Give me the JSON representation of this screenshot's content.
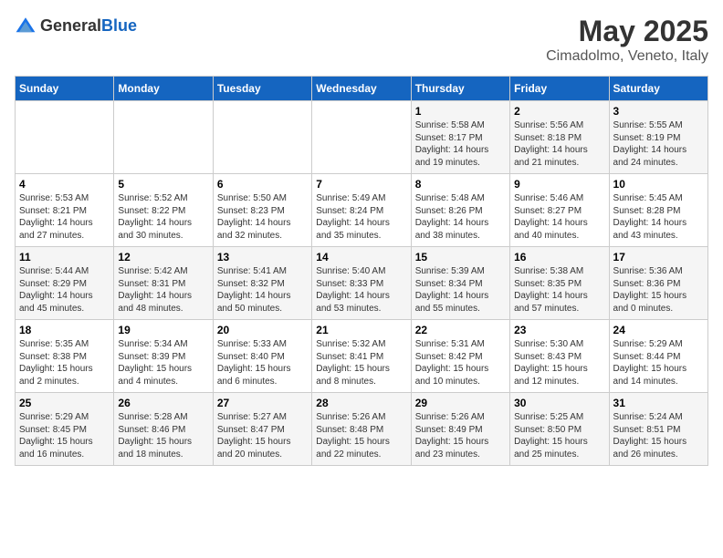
{
  "header": {
    "logo_general": "General",
    "logo_blue": "Blue",
    "main_title": "May 2025",
    "subtitle": "Cimadolmo, Veneto, Italy"
  },
  "weekdays": [
    "Sunday",
    "Monday",
    "Tuesday",
    "Wednesday",
    "Thursday",
    "Friday",
    "Saturday"
  ],
  "weeks": [
    [
      {
        "day": "",
        "info": ""
      },
      {
        "day": "",
        "info": ""
      },
      {
        "day": "",
        "info": ""
      },
      {
        "day": "",
        "info": ""
      },
      {
        "day": "1",
        "info": "Sunrise: 5:58 AM\nSunset: 8:17 PM\nDaylight: 14 hours\nand 19 minutes."
      },
      {
        "day": "2",
        "info": "Sunrise: 5:56 AM\nSunset: 8:18 PM\nDaylight: 14 hours\nand 21 minutes."
      },
      {
        "day": "3",
        "info": "Sunrise: 5:55 AM\nSunset: 8:19 PM\nDaylight: 14 hours\nand 24 minutes."
      }
    ],
    [
      {
        "day": "4",
        "info": "Sunrise: 5:53 AM\nSunset: 8:21 PM\nDaylight: 14 hours\nand 27 minutes."
      },
      {
        "day": "5",
        "info": "Sunrise: 5:52 AM\nSunset: 8:22 PM\nDaylight: 14 hours\nand 30 minutes."
      },
      {
        "day": "6",
        "info": "Sunrise: 5:50 AM\nSunset: 8:23 PM\nDaylight: 14 hours\nand 32 minutes."
      },
      {
        "day": "7",
        "info": "Sunrise: 5:49 AM\nSunset: 8:24 PM\nDaylight: 14 hours\nand 35 minutes."
      },
      {
        "day": "8",
        "info": "Sunrise: 5:48 AM\nSunset: 8:26 PM\nDaylight: 14 hours\nand 38 minutes."
      },
      {
        "day": "9",
        "info": "Sunrise: 5:46 AM\nSunset: 8:27 PM\nDaylight: 14 hours\nand 40 minutes."
      },
      {
        "day": "10",
        "info": "Sunrise: 5:45 AM\nSunset: 8:28 PM\nDaylight: 14 hours\nand 43 minutes."
      }
    ],
    [
      {
        "day": "11",
        "info": "Sunrise: 5:44 AM\nSunset: 8:29 PM\nDaylight: 14 hours\nand 45 minutes."
      },
      {
        "day": "12",
        "info": "Sunrise: 5:42 AM\nSunset: 8:31 PM\nDaylight: 14 hours\nand 48 minutes."
      },
      {
        "day": "13",
        "info": "Sunrise: 5:41 AM\nSunset: 8:32 PM\nDaylight: 14 hours\nand 50 minutes."
      },
      {
        "day": "14",
        "info": "Sunrise: 5:40 AM\nSunset: 8:33 PM\nDaylight: 14 hours\nand 53 minutes."
      },
      {
        "day": "15",
        "info": "Sunrise: 5:39 AM\nSunset: 8:34 PM\nDaylight: 14 hours\nand 55 minutes."
      },
      {
        "day": "16",
        "info": "Sunrise: 5:38 AM\nSunset: 8:35 PM\nDaylight: 14 hours\nand 57 minutes."
      },
      {
        "day": "17",
        "info": "Sunrise: 5:36 AM\nSunset: 8:36 PM\nDaylight: 15 hours\nand 0 minutes."
      }
    ],
    [
      {
        "day": "18",
        "info": "Sunrise: 5:35 AM\nSunset: 8:38 PM\nDaylight: 15 hours\nand 2 minutes."
      },
      {
        "day": "19",
        "info": "Sunrise: 5:34 AM\nSunset: 8:39 PM\nDaylight: 15 hours\nand 4 minutes."
      },
      {
        "day": "20",
        "info": "Sunrise: 5:33 AM\nSunset: 8:40 PM\nDaylight: 15 hours\nand 6 minutes."
      },
      {
        "day": "21",
        "info": "Sunrise: 5:32 AM\nSunset: 8:41 PM\nDaylight: 15 hours\nand 8 minutes."
      },
      {
        "day": "22",
        "info": "Sunrise: 5:31 AM\nSunset: 8:42 PM\nDaylight: 15 hours\nand 10 minutes."
      },
      {
        "day": "23",
        "info": "Sunrise: 5:30 AM\nSunset: 8:43 PM\nDaylight: 15 hours\nand 12 minutes."
      },
      {
        "day": "24",
        "info": "Sunrise: 5:29 AM\nSunset: 8:44 PM\nDaylight: 15 hours\nand 14 minutes."
      }
    ],
    [
      {
        "day": "25",
        "info": "Sunrise: 5:29 AM\nSunset: 8:45 PM\nDaylight: 15 hours\nand 16 minutes."
      },
      {
        "day": "26",
        "info": "Sunrise: 5:28 AM\nSunset: 8:46 PM\nDaylight: 15 hours\nand 18 minutes."
      },
      {
        "day": "27",
        "info": "Sunrise: 5:27 AM\nSunset: 8:47 PM\nDaylight: 15 hours\nand 20 minutes."
      },
      {
        "day": "28",
        "info": "Sunrise: 5:26 AM\nSunset: 8:48 PM\nDaylight: 15 hours\nand 22 minutes."
      },
      {
        "day": "29",
        "info": "Sunrise: 5:26 AM\nSunset: 8:49 PM\nDaylight: 15 hours\nand 23 minutes."
      },
      {
        "day": "30",
        "info": "Sunrise: 5:25 AM\nSunset: 8:50 PM\nDaylight: 15 hours\nand 25 minutes."
      },
      {
        "day": "31",
        "info": "Sunrise: 5:24 AM\nSunset: 8:51 PM\nDaylight: 15 hours\nand 26 minutes."
      }
    ]
  ]
}
